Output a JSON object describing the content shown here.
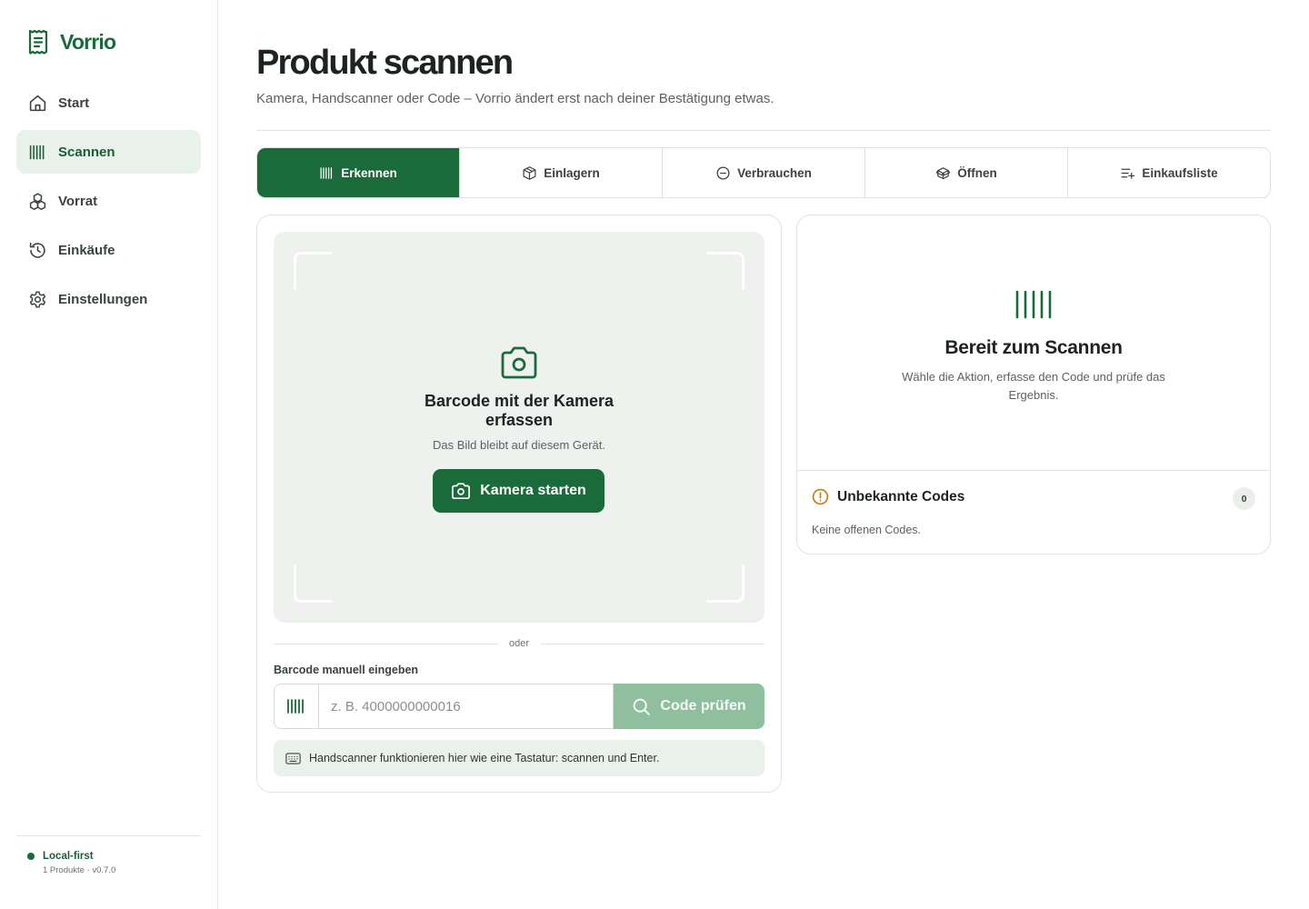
{
  "app": {
    "name": "Vorrio"
  },
  "sidebar": {
    "items": [
      {
        "label": "Start",
        "icon": "home-icon",
        "active": false
      },
      {
        "label": "Scannen",
        "icon": "barcode-icon",
        "active": true
      },
      {
        "label": "Vorrat",
        "icon": "boxes-icon",
        "active": false
      },
      {
        "label": "Einkäufe",
        "icon": "history-icon",
        "active": false
      },
      {
        "label": "Einstellungen",
        "icon": "gear-icon",
        "active": false
      }
    ],
    "footer": {
      "status": "Local-first",
      "meta": "1 Produkte · v0.7.0"
    }
  },
  "page": {
    "title": "Produkt scannen",
    "subtitle": "Kamera, Handscanner oder Code – Vorrio ändert erst nach deiner Bestätigung etwas."
  },
  "tabs": [
    {
      "label": "Erkennen",
      "icon": "barcode-icon",
      "active": true
    },
    {
      "label": "Einlagern",
      "icon": "package-icon",
      "active": false
    },
    {
      "label": "Verbrauchen",
      "icon": "minus-circle-icon",
      "active": false
    },
    {
      "label": "Öffnen",
      "icon": "open-box-icon",
      "active": false
    },
    {
      "label": "Einkaufsliste",
      "icon": "list-add-icon",
      "active": false
    }
  ],
  "camera": {
    "title": "Barcode mit der Kamera erfassen",
    "hint": "Das Bild bleibt auf diesem Gerät.",
    "button": "Kamera starten"
  },
  "divider_text": "oder",
  "manual": {
    "label": "Barcode manuell eingeben",
    "placeholder": "z. B. 4000000000016",
    "value": "",
    "button": "Code prüfen"
  },
  "hint": "Handscanner funktionieren hier wie eine Tastatur: scannen und Enter.",
  "result": {
    "title": "Bereit zum Scannen",
    "text": "Wähle die Aktion, erfasse den Code und prüfe das Ergebnis.",
    "unknown_title": "Unbekannte Codes",
    "unknown_count": "0",
    "unknown_empty": "Keine offenen Codes."
  },
  "colors": {
    "primary": "#1b6a3a",
    "primary_light": "#e8f1ea",
    "button_disabled": "#8fbf9e",
    "warning": "#c07a1a"
  }
}
